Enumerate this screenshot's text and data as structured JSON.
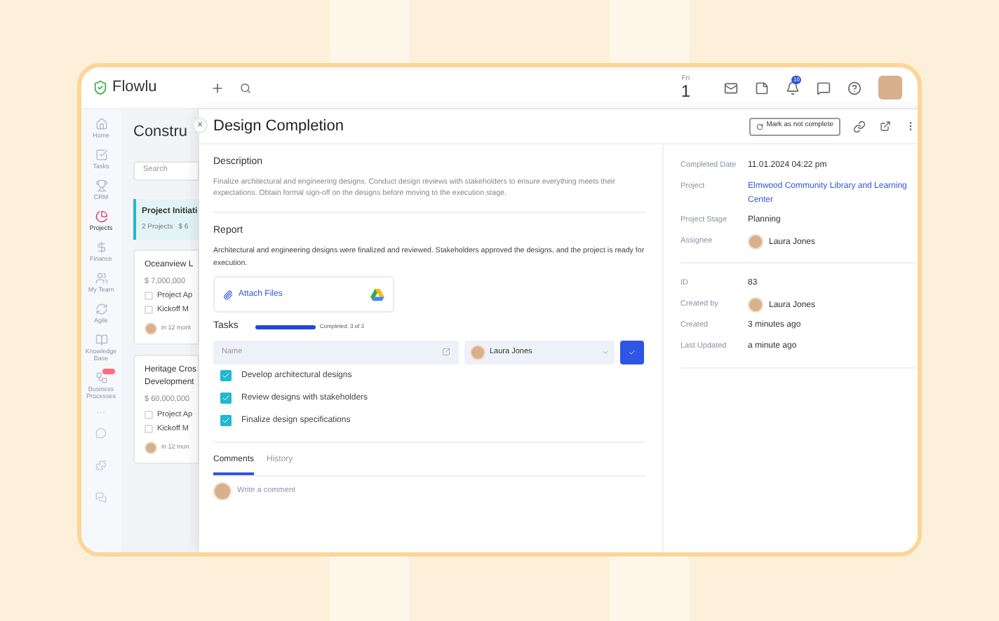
{
  "app": {
    "logo": "Flowlu"
  },
  "topbar": {
    "day": "Fri",
    "date": "1",
    "notifications": "10"
  },
  "nav": [
    {
      "label": "Home",
      "selected": false,
      "badge": false
    },
    {
      "label": "Tasks",
      "selected": false,
      "badge": false
    },
    {
      "label": "CRM",
      "selected": false,
      "badge": false
    },
    {
      "label": "Projects",
      "selected": true,
      "badge": false
    },
    {
      "label": "Finance",
      "selected": false,
      "badge": false
    },
    {
      "label": "My Team",
      "selected": false,
      "badge": false
    },
    {
      "label": "Agile",
      "selected": false,
      "badge": false
    },
    {
      "label": "Knowledge Base",
      "selected": false,
      "badge": false
    },
    {
      "label": "Business Processes",
      "selected": false,
      "badge": true
    }
  ],
  "nav_more": "···",
  "board": {
    "title": "Constru",
    "search_placeholder": "Search",
    "stage": {
      "name": "Project Initiati",
      "count": "2 Projects",
      "amount": "$ 6"
    },
    "cards": [
      {
        "title": [
          "Oceanview L"
        ],
        "amount": "$ 7,000,000",
        "checklist": [
          {
            "label": "Project Ap",
            "checked": false
          },
          {
            "label": "Kickoff M",
            "checked": false
          }
        ],
        "due": "in 12 mont"
      },
      {
        "title": [
          "Heritage Cros",
          "Development"
        ],
        "amount": "$ 60,000,000",
        "checklist": [
          {
            "label": "Project Ap",
            "checked": false
          },
          {
            "label": "Kickoff M",
            "checked": false
          }
        ],
        "due": "in 12 mon"
      }
    ]
  },
  "detail": {
    "close": "×",
    "title": "Design Completion",
    "action": "Mark as not complete",
    "description": {
      "heading": "Description",
      "text": "Finalize architectural and engineering designs. Conduct design reviews with stakeholders to ensure everything meets their expectations. Obtain formal sign-off on the designs before moving to the execution stage."
    },
    "report": {
      "heading": "Report",
      "text": "Architectural and engineering designs were finalized and reviewed. Stakeholders approved the designs, and the project is ready for execution."
    },
    "attach": "Attach Files",
    "tasks": {
      "heading": "Tasks",
      "level": 1,
      "progress_text": "Completed: 3 of 3",
      "name_placeholder": "Name",
      "assignee": "Laura Jones",
      "items": [
        {
          "label": "Develop architectural designs",
          "checked": true
        },
        {
          "label": "Review designs with stakeholders",
          "checked": true
        },
        {
          "label": "Finalize design specifications",
          "checked": true
        }
      ]
    },
    "tabs": [
      {
        "label": "Comments",
        "selected": true
      },
      {
        "label": "History",
        "selected": false
      }
    ],
    "comment_placeholder": "Write a comment",
    "fields": [
      {
        "label": "Completed Date",
        "value": "11.01.2024 04:22 pm",
        "kind": "text"
      },
      {
        "label": "Project",
        "value": "Elmwood Community Library and Learning Center",
        "kind": "link"
      },
      {
        "label": "Project Stage",
        "value": "Planning",
        "kind": "text"
      },
      {
        "label": "Assignee",
        "value": "Laura Jones",
        "kind": "person"
      }
    ],
    "meta": [
      {
        "label": "ID",
        "value": "83",
        "kind": "text"
      },
      {
        "label": "Created by",
        "value": "Laura Jones",
        "kind": "person"
      },
      {
        "label": "Created",
        "value": "3 minutes ago",
        "kind": "text"
      },
      {
        "label": "Last Updated",
        "value": "a minute ago",
        "kind": "text"
      }
    ]
  }
}
